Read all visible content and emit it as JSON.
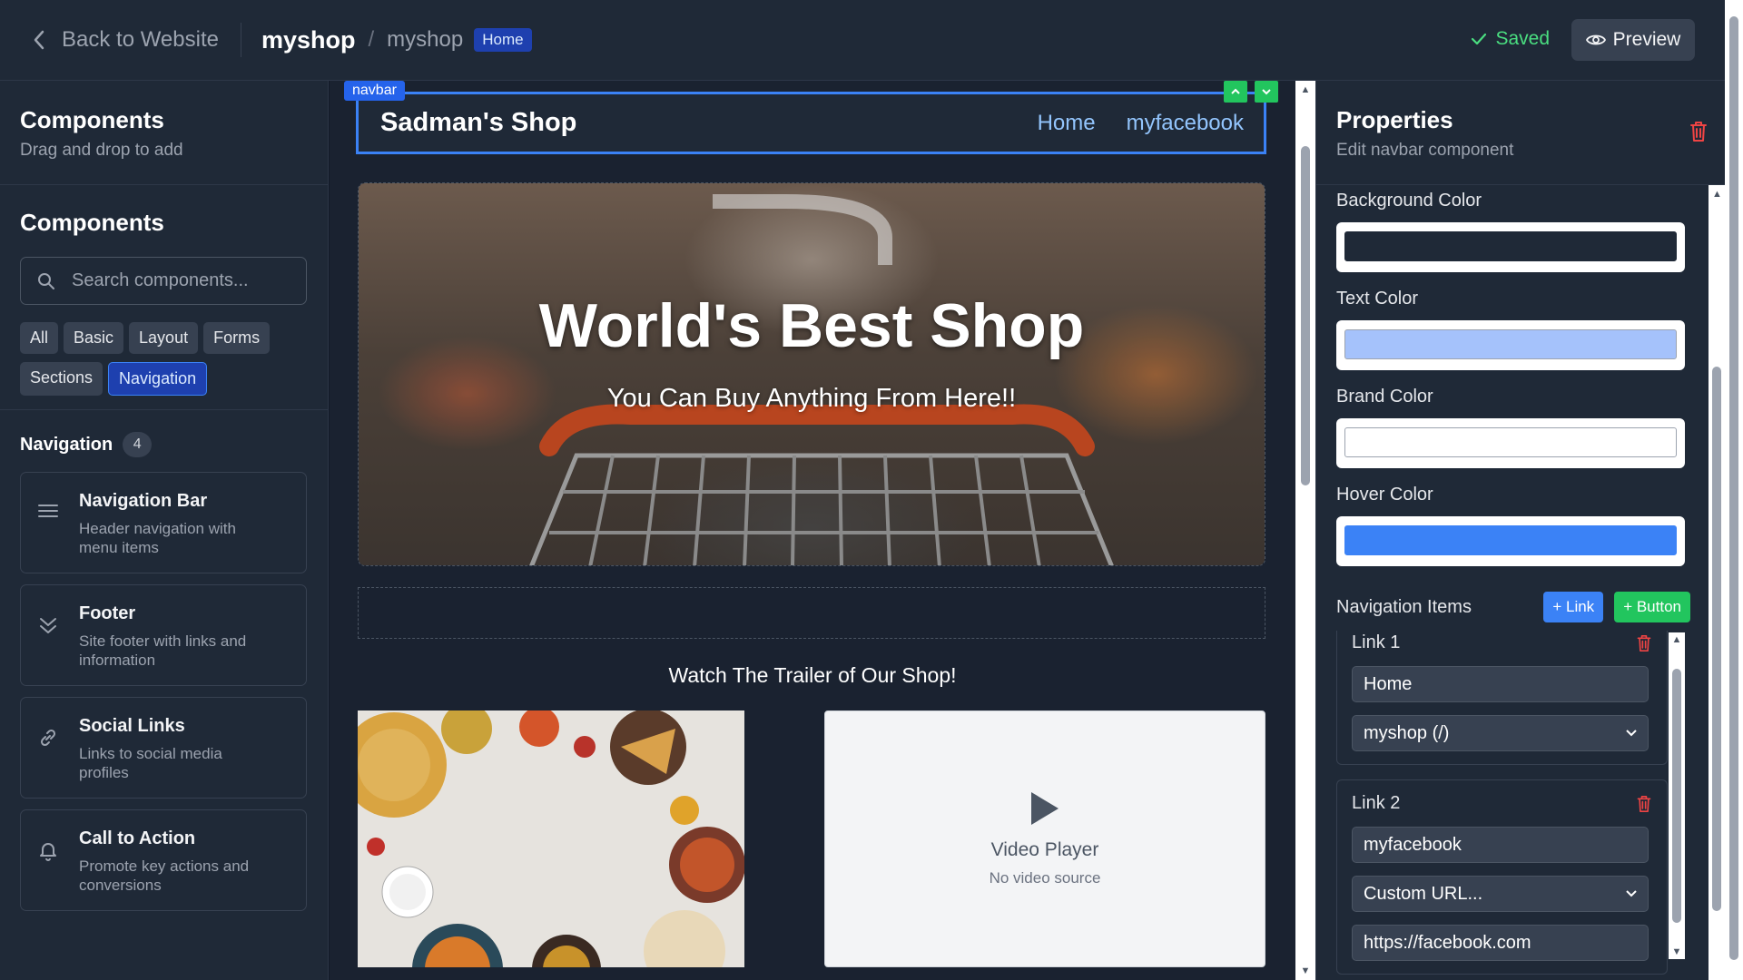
{
  "header": {
    "back_label": "Back to Website",
    "crumb_main": "myshop",
    "crumb_sep": "/",
    "crumb_sub": "myshop",
    "page_badge": "Home",
    "saved_label": "Saved",
    "preview_label": "Preview"
  },
  "left": {
    "title": "Components",
    "subtitle": "Drag and drop to add",
    "section_title": "Components",
    "search_placeholder": "Search components...",
    "chips": [
      "All",
      "Basic",
      "Layout",
      "Forms",
      "Sections",
      "Navigation"
    ],
    "active_chip": "Navigation",
    "category_title": "Navigation",
    "category_count": "4",
    "cards": [
      {
        "title": "Navigation Bar",
        "desc": "Header navigation with menu items",
        "icon": "menu-icon"
      },
      {
        "title": "Footer",
        "desc": "Site footer with links and information",
        "icon": "chevrons-down-icon"
      },
      {
        "title": "Social Links",
        "desc": "Links to social media profiles",
        "icon": "link-icon"
      },
      {
        "title": "Call to Action",
        "desc": "Promote key actions and conversions",
        "icon": "bell-icon"
      }
    ]
  },
  "canvas": {
    "navbar_tag": "navbar",
    "brand": "Sadman's Shop",
    "nav_links": [
      "Home",
      "myfacebook"
    ],
    "hero_title": "World's Best Shop",
    "hero_subtitle": "You Can Buy Anything From Here!!",
    "trailer_text": "Watch The Trailer of Our Shop!",
    "video_title": "Video Player",
    "video_sub": "No video source"
  },
  "right": {
    "title": "Properties",
    "subtitle": "Edit navbar component",
    "fields": [
      {
        "label": "Background Color",
        "color": "#1f2937"
      },
      {
        "label": "Text Color",
        "color": "#a5c2fb"
      },
      {
        "label": "Brand Color",
        "color": "#ffffff"
      },
      {
        "label": "Hover Color",
        "color": "#3b82f6"
      }
    ],
    "nav_items_label": "Navigation Items",
    "add_link_label": "+ Link",
    "add_button_label": "+ Button",
    "link1": {
      "title": "Link 1",
      "text": "Home",
      "target": "myshop (/)"
    },
    "link2": {
      "title": "Link 2",
      "text": "myfacebook",
      "target": "Custom URL...",
      "url": "https://facebook.com"
    }
  },
  "colors": {
    "accent": "#3b82f6",
    "success": "#22c55e",
    "danger": "#ef4444"
  }
}
